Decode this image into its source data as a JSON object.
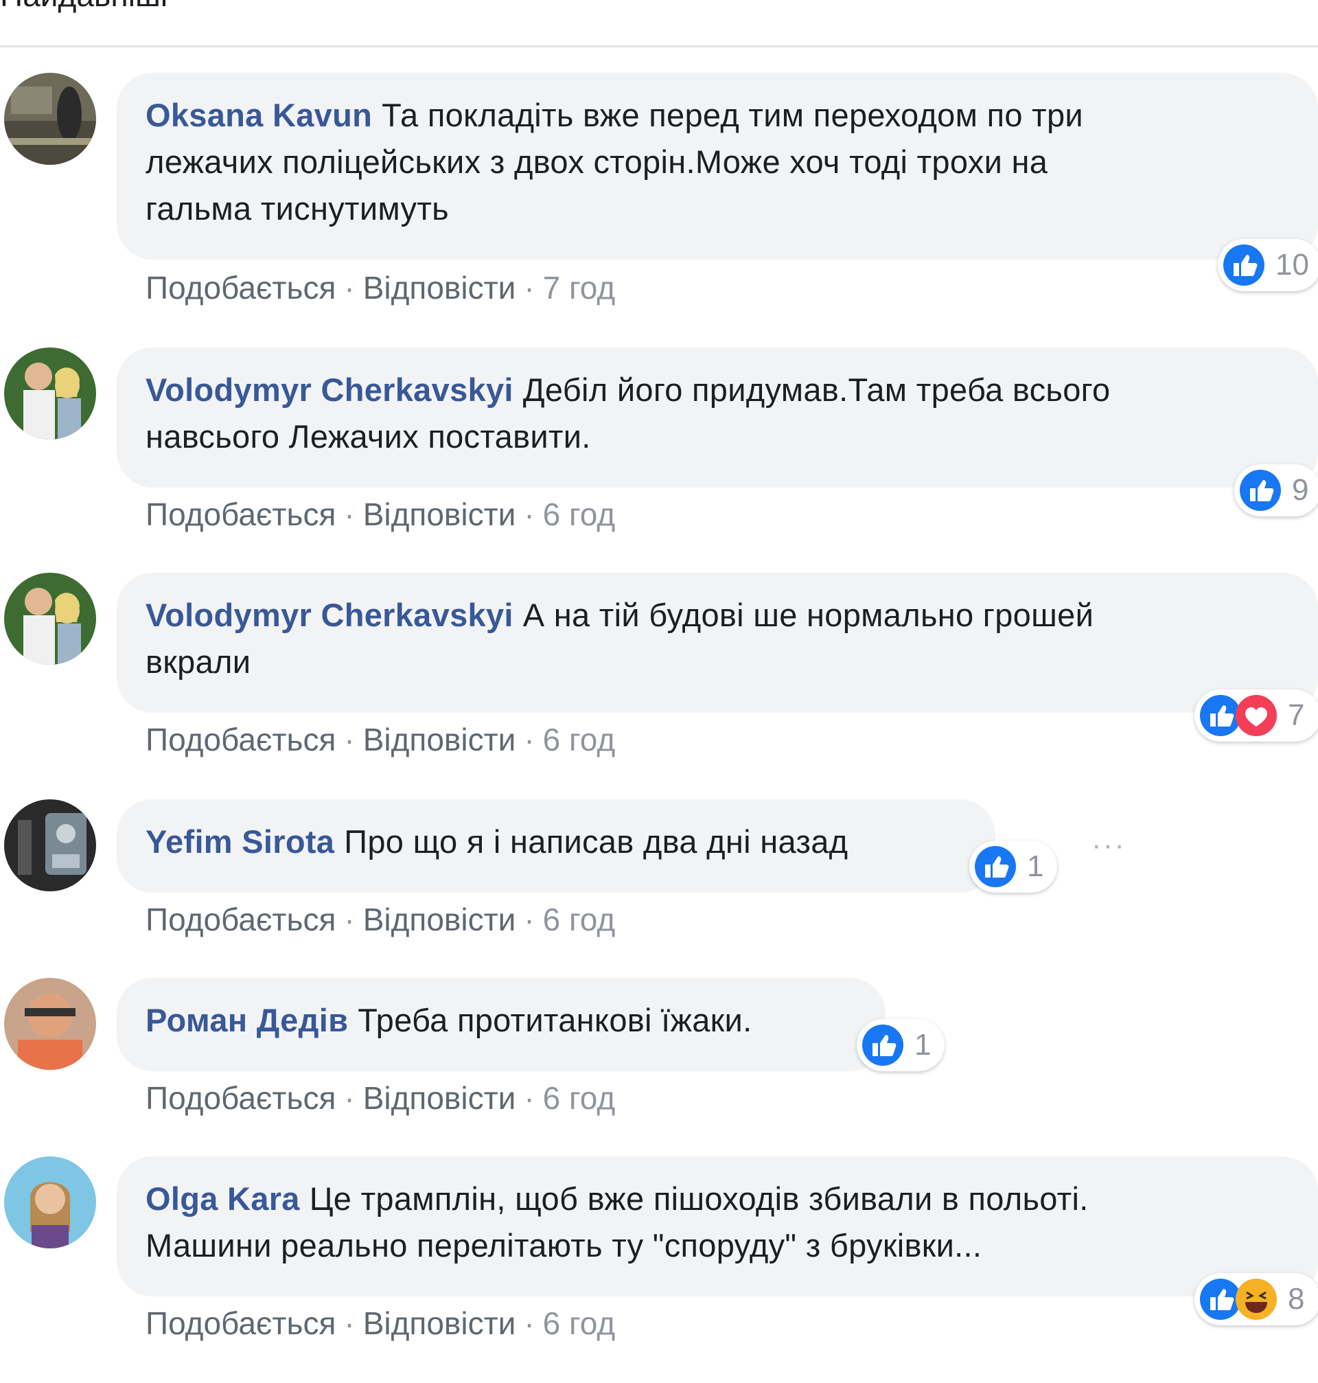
{
  "header_fragment": "Найдавніші",
  "reply_label": "Відповісти",
  "like_label": "Подобається",
  "comments": [
    {
      "author": "Oksana Kavun",
      "text_lines": [
        "Та покладіть вже перед тим переходом по три",
        "лежачих поліцейських з двох сторін.Може хоч тоді трохи на",
        "гальма тиснутимуть"
      ],
      "time": "7 год",
      "reactions": [
        "like-icon"
      ],
      "reaction_count": "10"
    },
    {
      "author": "Volodymyr Cherkavskyi",
      "text_lines": [
        "Дебіл його придумав.Там треба всього",
        "навсього Лежачих поставити."
      ],
      "time": "6 год",
      "reactions": [
        "like-icon"
      ],
      "reaction_count": "9"
    },
    {
      "author": "Volodymyr Cherkavskyi",
      "text_lines": [
        "А на тій будові ше нормально грошей",
        "вкрали"
      ],
      "time": "6 год",
      "reactions": [
        "like-icon",
        "love-icon"
      ],
      "reaction_count": "7"
    },
    {
      "author": "Yefim Sirota",
      "text_lines": [
        "Про що я і написав два дні назад"
      ],
      "time": "6 год",
      "reactions": [
        "like-icon"
      ],
      "reaction_count": "1",
      "more_label": "···"
    },
    {
      "author": "Роман Дедів",
      "text_lines": [
        "Треба протитанкові їжаки."
      ],
      "time": "6 год",
      "reactions": [
        "like-icon"
      ],
      "reaction_count": "1"
    },
    {
      "author": "Olga Kara",
      "text_lines": [
        "Це трамплін, щоб вже пішоходів збивали в польоті.",
        "Машини реально перелітають ту \"споруду\" з бруківки..."
      ],
      "time": "6 год",
      "reactions": [
        "like-icon",
        "haha-icon"
      ],
      "reaction_count": "8"
    }
  ],
  "colors": {
    "author": "#385898",
    "bubble": "#f2f3f5",
    "like": "#1877f2",
    "love": "#f33e58",
    "haha": "#f7b125",
    "meta": "#90949c"
  }
}
